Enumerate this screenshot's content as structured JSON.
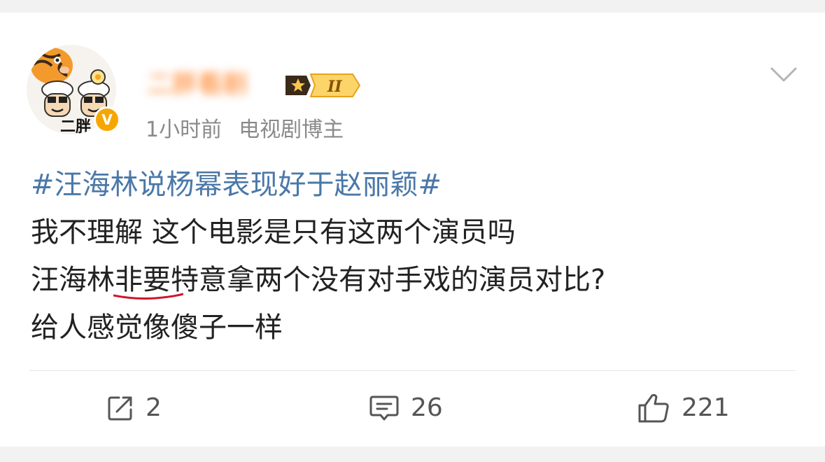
{
  "post": {
    "author": {
      "name": "二胖看剧",
      "level_label": "II",
      "avatar_text": "二胖",
      "verified_mark": "V"
    },
    "time": "1小时前",
    "source": "电视剧博主",
    "hashtag": "#汪海林说杨幂表现好于赵丽颖#",
    "lines": {
      "line1": "我不理解 这个电影是只有这两个演员吗",
      "line2_prefix": "汪海林",
      "line2_underlined": "非要特意拿两个没有对手戏的演员对比?",
      "line3": "给人感觉像傻子一样"
    }
  },
  "actions": {
    "share_count": "2",
    "comment_count": "26",
    "like_count": "221"
  },
  "colors": {
    "hashtag": "#4a78a8",
    "username": "#ff7a1a",
    "underline": "#d0142c",
    "badge": "#f7a600"
  },
  "icons": {
    "share": "share-icon",
    "comment": "comment-icon",
    "like": "thumbs-up-icon",
    "menu": "chevron-down-icon"
  }
}
